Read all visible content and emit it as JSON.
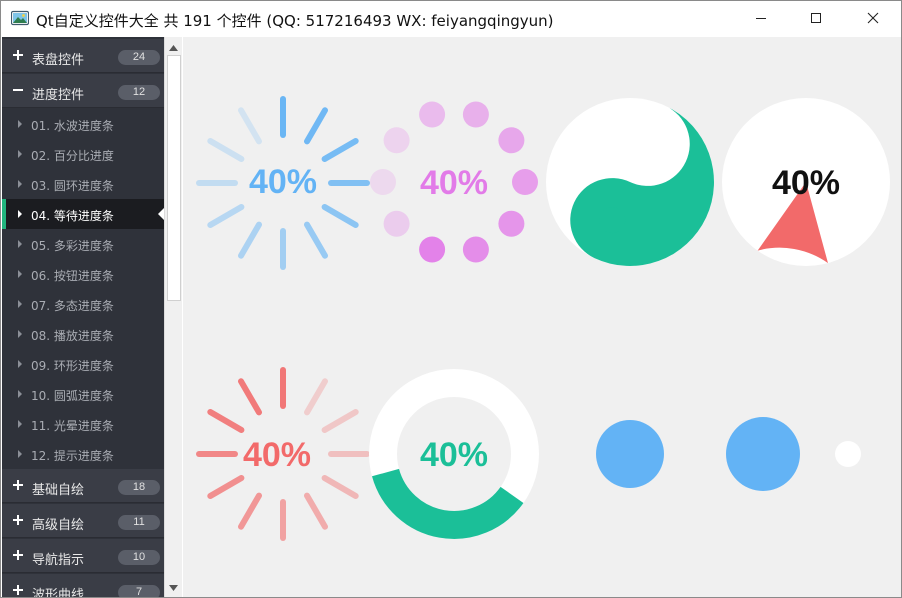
{
  "window": {
    "title": "Qt自定义控件大全 共 191 个控件 (QQ: 517216493 WX: feiyangqingyun)"
  },
  "icons": {
    "app": "app-image-icon",
    "minimize": "minimize-icon",
    "maximize": "maximize-icon",
    "close": "close-icon",
    "expand": "plus-icon",
    "collapse": "minus-icon",
    "item": "caret-right-icon"
  },
  "colors": {
    "sidebar_bg": "#2f323a",
    "group_bg": "#3a3d46",
    "active_bg": "#1b1c20",
    "accent": "#21b57e",
    "blue": "#63b3f5",
    "pink": "#e27be8",
    "teal": "#1bbf98",
    "red": "#f26a6a",
    "content_bg": "#f0f0f0"
  },
  "sidebar": {
    "groups_top": [
      {
        "label": "表盘控件",
        "count": "24",
        "expanded": false
      },
      {
        "label": "进度控件",
        "count": "12",
        "expanded": true
      }
    ],
    "children": [
      {
        "label": "01. 水波进度条",
        "active": false
      },
      {
        "label": "02. 百分比进度",
        "active": false
      },
      {
        "label": "03. 圆环进度条",
        "active": false
      },
      {
        "label": "04. 等待进度条",
        "active": true
      },
      {
        "label": "05. 多彩进度条",
        "active": false
      },
      {
        "label": "06. 按钮进度条",
        "active": false
      },
      {
        "label": "07. 多态进度条",
        "active": false
      },
      {
        "label": "08. 播放进度条",
        "active": false
      },
      {
        "label": "09. 环形进度条",
        "active": false
      },
      {
        "label": "10. 圆弧进度条",
        "active": false
      },
      {
        "label": "11. 光晕进度条",
        "active": false
      },
      {
        "label": "12. 提示进度条",
        "active": false
      }
    ],
    "groups_bottom": [
      {
        "label": "基础自绘",
        "count": "18",
        "expanded": false
      },
      {
        "label": "高级自绘",
        "count": "11",
        "expanded": false
      },
      {
        "label": "导航指示",
        "count": "10",
        "expanded": false
      },
      {
        "label": "波形曲线",
        "count": "7",
        "expanded": false
      }
    ]
  },
  "widgets": {
    "spinner_blue": {
      "text": "40%",
      "value": 40,
      "color": "#63b3f5"
    },
    "dots_pink": {
      "text": "40%",
      "value": 40,
      "color": "#e27be8"
    },
    "taiji": {
      "color": "#1bbf98"
    },
    "pie": {
      "text": "40%",
      "value": 40,
      "color": "#f26a6a"
    },
    "spinner_red": {
      "text": "40%",
      "value": 40,
      "color": "#f26a6a"
    },
    "ring_teal": {
      "text": "40%",
      "value": 40,
      "color": "#1bbf98"
    },
    "bubbles": {
      "color": "#63b3f5"
    }
  }
}
